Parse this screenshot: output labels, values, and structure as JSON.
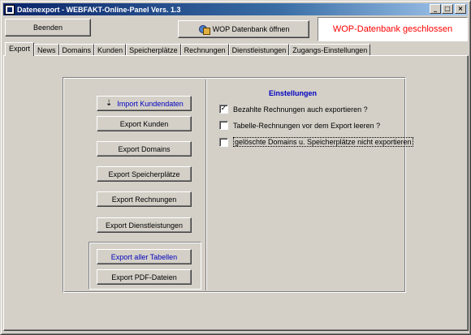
{
  "window": {
    "title": "Datenexport  -  WEBFAKT-Online-Panel Vers. 1.3",
    "minimize": "_",
    "maximize": "□",
    "close": "×"
  },
  "toolbar": {
    "quit_label": "Beenden",
    "open_db_label": "WOP Datenbank öffnen",
    "status_text": "WOP-Datenbank geschlossen"
  },
  "tabs": [
    {
      "label": "Export",
      "active": true
    },
    {
      "label": "News"
    },
    {
      "label": "Domains"
    },
    {
      "label": "Kunden"
    },
    {
      "label": "Speicherplätze"
    },
    {
      "label": "Rechnungen"
    },
    {
      "label": "Dienstleistungen"
    },
    {
      "label": "Zugangs-Einstellungen"
    }
  ],
  "export": {
    "import_customers": "Import Kundendaten",
    "export_customers": "Export Kunden",
    "export_domains": "Export Domains",
    "export_storage": "Export Speicherplätze",
    "export_invoices": "Export Rechnungen",
    "export_services": "Export Dienstleistungen",
    "export_all": "Export aller Tabellen",
    "export_pdf": "Export PDF-Dateien"
  },
  "settings": {
    "title": "Einstellungen",
    "options": [
      {
        "label": "Bezahlte Rechnungen auch exportieren ?",
        "checked": true
      },
      {
        "label": "Tabelle-Rechnungen vor dem Export leeren ?",
        "checked": false
      },
      {
        "label": "gelöschte Domains u. Speicherplätze nicht exportieren",
        "checked": false
      }
    ]
  },
  "colors": {
    "status_text": "#ff0000",
    "accent_blue": "#0000c0",
    "title_gradient_start": "#0a246a"
  },
  "icons": {
    "open_db": "database-icon",
    "import": "import-icon",
    "app": "app-icon"
  }
}
